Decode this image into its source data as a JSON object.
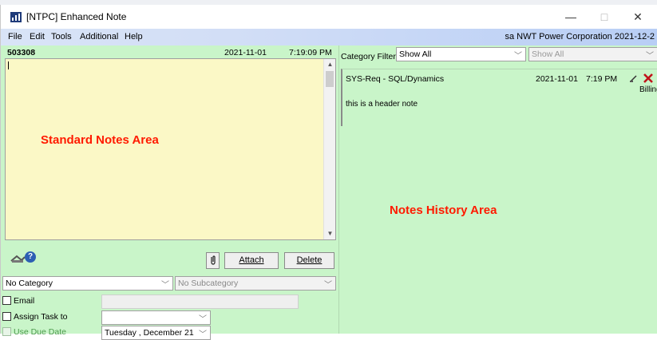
{
  "window": {
    "title": "[NTPC] Enhanced Note",
    "minimize": "—",
    "maximize": "□",
    "close": "✕"
  },
  "menu": {
    "items": [
      "File",
      "Edit",
      "Tools",
      "Additional",
      "Help"
    ],
    "status": "sa  NWT Power Corporation  2021-12-2"
  },
  "note": {
    "id": "503308",
    "date": "2021-11-01",
    "time": "7:19:09 PM",
    "overlay_label": "Standard Notes Area",
    "attach_label": "Attach",
    "delete_label": "Delete",
    "category": "No Category",
    "subcategory": "No Subcategory",
    "email_label": "Email",
    "assign_label": "Assign Task to",
    "due_label": "Use Due Date",
    "due_date": "Tuesday  , December 21"
  },
  "history": {
    "filter_label": "Category Filter",
    "filter_value": "Show All",
    "filter2_value": "Show All",
    "entry": {
      "title": "SYS-Req - SQL/Dynamics",
      "date": "2021-11-01",
      "time": "7:19 PM",
      "billing": "Billing",
      "body": "this is a header note"
    },
    "overlay_label": "Notes History Area"
  },
  "colors": {
    "panel_bg": "#c9f5c9",
    "note_bg": "#fbf8c6",
    "overlay_red": "#ff1a00",
    "app_icon": "#1f3b7a"
  }
}
